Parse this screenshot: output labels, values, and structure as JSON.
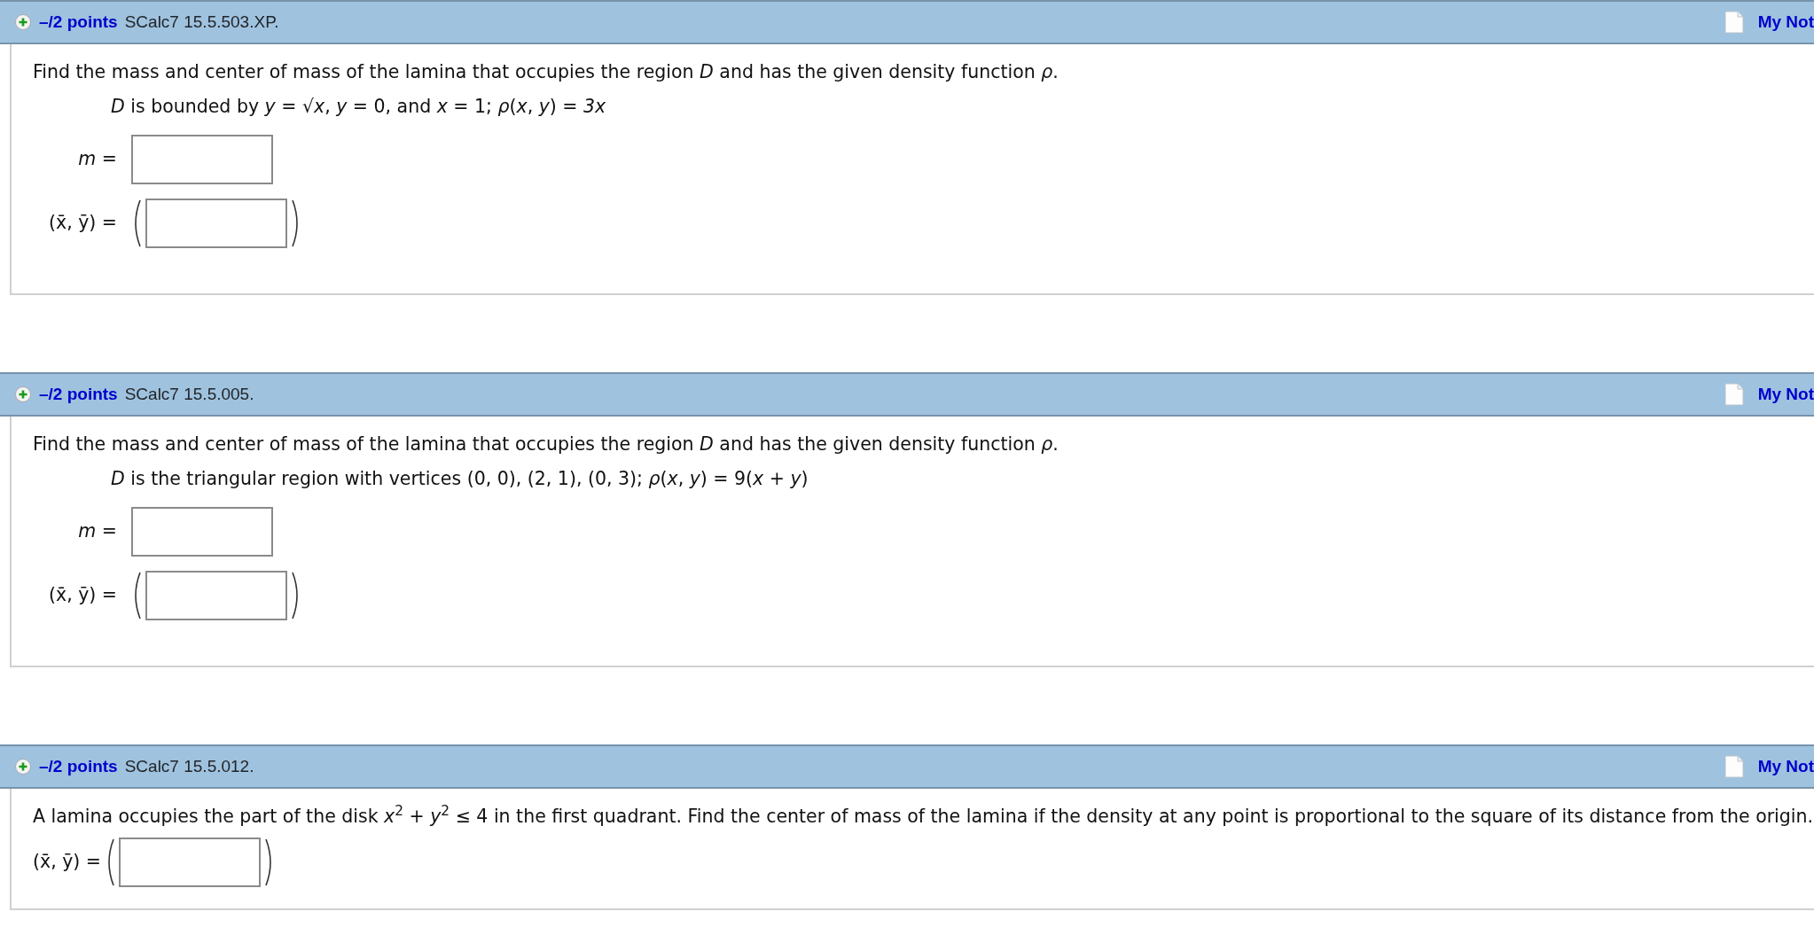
{
  "questions": [
    {
      "points": "–/2 points",
      "code": "SCalc7 15.5.503.XP.",
      "notes_link": "My Not",
      "prompt": "Find the mass and center of mass of the lamina that occupies the region *D* and has the given density function *ρ*.",
      "given": "*D* is bounded by  *y* = √*x*, *y* = 0, and *x* = 1;  *ρ*(*x*, *y*) = *3x*",
      "answers": [
        {
          "kind": "scalar",
          "label": "*m* ="
        },
        {
          "kind": "pair",
          "label": "(x̄, ȳ) ="
        }
      ]
    },
    {
      "points": "–/2 points",
      "code": "SCalc7 15.5.005.",
      "notes_link": "My Not",
      "prompt": "Find the mass and center of mass of the lamina that occupies the region *D* and has the given density function *ρ*.",
      "given": "*D* is the triangular region with vertices (0, 0), (2, 1), (0, 3); *ρ*(*x*, *y*) = 9(*x* + *y*)",
      "answers": [
        {
          "kind": "scalar",
          "label": "*m* ="
        },
        {
          "kind": "pair",
          "label": "(x̄, ȳ) ="
        }
      ]
    },
    {
      "points": "–/2 points",
      "code": "SCalc7 15.5.012.",
      "notes_link": "My Not",
      "prompt": "A lamina occupies the part of the disk *x*$^{2}$ + *y*$^{2}$ ≤ 4 in the first quadrant. Find the center of mass of the lamina if the density at any point is proportional to the square of its distance from the origin.",
      "answers": [
        {
          "kind": "pair-inline",
          "label": "(x̄, ȳ) ="
        }
      ]
    }
  ]
}
